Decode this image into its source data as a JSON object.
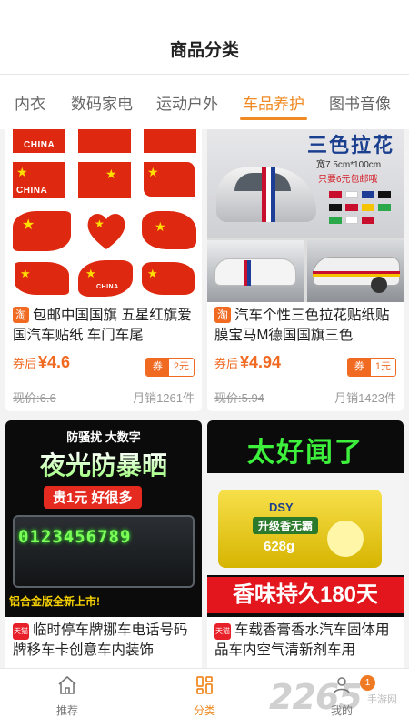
{
  "header": {
    "title": "商品分类"
  },
  "tabs": [
    {
      "label": "内衣"
    },
    {
      "label": "数码家电"
    },
    {
      "label": "运动户外"
    },
    {
      "label": "车品养护",
      "active": true
    },
    {
      "label": "图书音像"
    }
  ],
  "products": [
    {
      "platform_tag": "淘",
      "title": "包邮中国国旗 五星红旗爱国汽车贴纸 车门车尾",
      "after_label": "券后",
      "price": "¥4.6",
      "coupon_label": "券",
      "coupon_value": "2元",
      "original_price": "现价:6.6",
      "monthly_sales": "月销1261件",
      "image_text": [
        "CHINA",
        "CHINA",
        "CHINA"
      ]
    },
    {
      "platform_tag": "淘",
      "title": "汽车个性三色拉花贴纸贴膜宝马M德国国旗三色",
      "after_label": "券后",
      "price": "¥4.94",
      "coupon_label": "券",
      "coupon_value": "1元",
      "original_price": "现价:5.94",
      "monthly_sales": "月销1423件",
      "image_text": [
        "三色拉花",
        "宽7.5cm*100cm",
        "只要6元包邮哦"
      ]
    },
    {
      "platform_tag": "天猫",
      "title": "临时停车牌挪车电话号码牌移车卡创意车内装饰",
      "image_text": [
        "防骚扰 大数字",
        "夜光防暴晒",
        "贵1元 好很多",
        "0123456789",
        "铝合金版全新上市!"
      ]
    },
    {
      "platform_tag": "天猫",
      "title": "车载香膏香水汽车固体用品车内空气清新剂车用",
      "image_text": [
        "太好闻了",
        "DSY",
        "升级香无霸",
        "628g",
        "香味持久180天"
      ]
    }
  ],
  "bottom_nav": [
    {
      "label": "推荐",
      "icon": "home-icon"
    },
    {
      "label": "分类",
      "icon": "category-icon",
      "active": true
    },
    {
      "label": "我的",
      "icon": "user-icon",
      "badge": "1"
    }
  ],
  "watermark": {
    "main": "2265",
    "sub": "手游网"
  },
  "colors": {
    "accent": "#f08a24",
    "price": "#f06a22",
    "flag_red": "#de2910",
    "glow_green": "#7dff5a"
  }
}
